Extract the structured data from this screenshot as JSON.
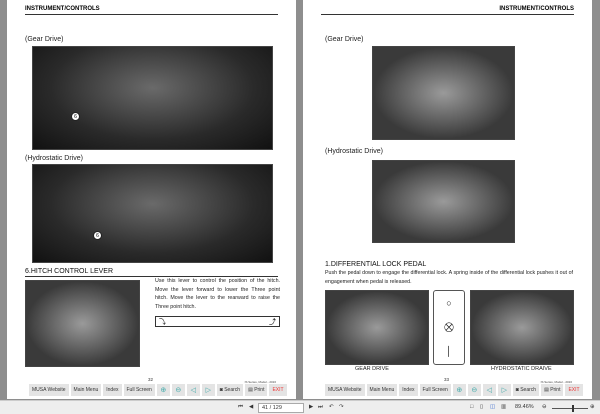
{
  "header": "INSTRUMENT/CONTROLS",
  "left": {
    "gear": "(Gear Drive)",
    "hydro": "(Hydrostatic Drive)",
    "section": "6.HITCH CONTROL LEVER",
    "text": "Use this lever to control the position of the hitch. Move the lever forward to lower the Three point hitch. Move the lever to the rearward to raise the Three point hitch.",
    "page": "32",
    "callout": "6",
    "callout2": "6"
  },
  "right": {
    "gear": "(Gear Drive)",
    "hydro": "(Hydrostatic Drive)",
    "section": "1.DIFFERENTIAL LOCK PEDAL",
    "text": "Push the pedal down to engage the differential lock. A spring inside of the differential lock pushes it out of engagement when pedal is released.",
    "cap1": "GEAR DRIVE",
    "cap2": "HYDROSTATIC DRAIVE",
    "page": "33"
  },
  "model": "IS Series, Model - 2016",
  "nav": {
    "website": "MUSA Website",
    "menu": "Main Menu",
    "index": "Index",
    "full": "Full Screen",
    "search": "Search",
    "print": "Print",
    "exit": "EXIT"
  },
  "viewer": {
    "page": "41 / 129",
    "zoom": "89.46%"
  }
}
